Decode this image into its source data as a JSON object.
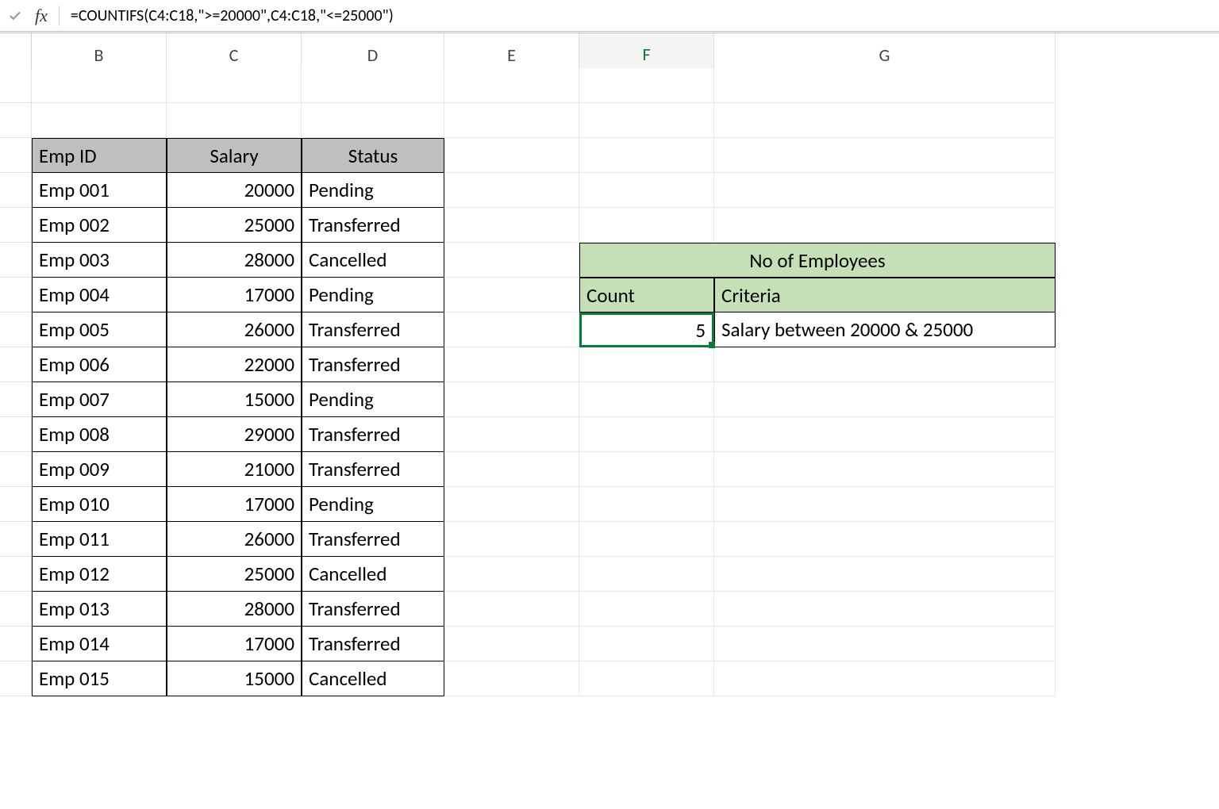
{
  "formula_bar": {
    "fx_label": "fx",
    "formula": "=COUNTIFS(C4:C18,\">=20000\",C4:C18,\"<=25000\")"
  },
  "columns": [
    "B",
    "C",
    "D",
    "E",
    "F",
    "G"
  ],
  "active_column": "F",
  "headers": {
    "emp_id": "Emp ID",
    "salary": "Salary",
    "status": "Status"
  },
  "rows": [
    {
      "emp": "Emp 001",
      "salary": "20000",
      "status": "Pending"
    },
    {
      "emp": "Emp 002",
      "salary": "25000",
      "status": "Transferred"
    },
    {
      "emp": "Emp 003",
      "salary": "28000",
      "status": "Cancelled"
    },
    {
      "emp": "Emp 004",
      "salary": "17000",
      "status": "Pending"
    },
    {
      "emp": "Emp 005",
      "salary": "26000",
      "status": "Transferred"
    },
    {
      "emp": "Emp 006",
      "salary": "22000",
      "status": "Transferred"
    },
    {
      "emp": "Emp 007",
      "salary": "15000",
      "status": "Pending"
    },
    {
      "emp": "Emp 008",
      "salary": "29000",
      "status": "Transferred"
    },
    {
      "emp": "Emp 009",
      "salary": "21000",
      "status": "Transferred"
    },
    {
      "emp": "Emp 010",
      "salary": "17000",
      "status": "Pending"
    },
    {
      "emp": "Emp 011",
      "salary": "26000",
      "status": "Transferred"
    },
    {
      "emp": "Emp 012",
      "salary": "25000",
      "status": "Cancelled"
    },
    {
      "emp": "Emp 013",
      "salary": "28000",
      "status": "Transferred"
    },
    {
      "emp": "Emp 014",
      "salary": "17000",
      "status": "Transferred"
    },
    {
      "emp": "Emp 015",
      "salary": "15000",
      "status": "Cancelled"
    }
  ],
  "summary": {
    "title": "No of Employees",
    "count_label": "Count",
    "criteria_label": "Criteria",
    "count_value": "5",
    "criteria_value": "Salary between 20000 & 25000"
  }
}
